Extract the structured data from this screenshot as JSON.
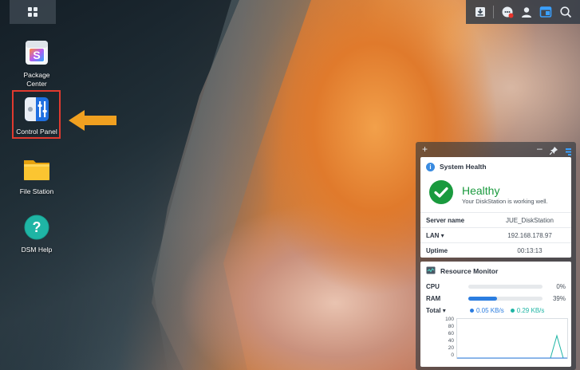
{
  "desktop": {
    "icons": [
      {
        "label": "Package\nCenter",
        "name": "package-center"
      },
      {
        "label": "Control Panel",
        "name": "control-panel"
      },
      {
        "label": "File Station",
        "name": "file-station"
      },
      {
        "label": "DSM Help",
        "name": "dsm-help"
      }
    ],
    "highlight_color": "#e03a2f",
    "arrow_color": "#f0a020"
  },
  "tray": {
    "icons": [
      "download-icon",
      "notification-icon",
      "user-icon",
      "widgets-icon",
      "search-icon"
    ]
  },
  "widget_toolbar": {
    "add": "+",
    "minimize": "–",
    "pin": "pin-icon",
    "settings": "widget-menu-icon"
  },
  "system_health": {
    "title": "System Health",
    "status": "Healthy",
    "message": "Your DiskStation is working well.",
    "status_color": "#1a9a3e",
    "rows": [
      {
        "key": "Server name",
        "value": "JUE_DiskStation"
      },
      {
        "key": "LAN ▾",
        "value": "192.168.178.97"
      },
      {
        "key": "Uptime",
        "value": "00:13:13"
      }
    ]
  },
  "resource_monitor": {
    "title": "Resource Monitor",
    "cpu": {
      "label": "CPU",
      "percent": 0,
      "display": "0%"
    },
    "ram": {
      "label": "RAM",
      "percent": 39,
      "display": "39%"
    },
    "total": {
      "label": "Total ▾",
      "upload": "0.05 KB/s",
      "download": "0.29 KB/s"
    },
    "upload_color": "#2b7de0",
    "download_color": "#1fb5a5",
    "chart_ticks": [
      "100",
      "80",
      "60",
      "40",
      "20",
      "0"
    ]
  }
}
